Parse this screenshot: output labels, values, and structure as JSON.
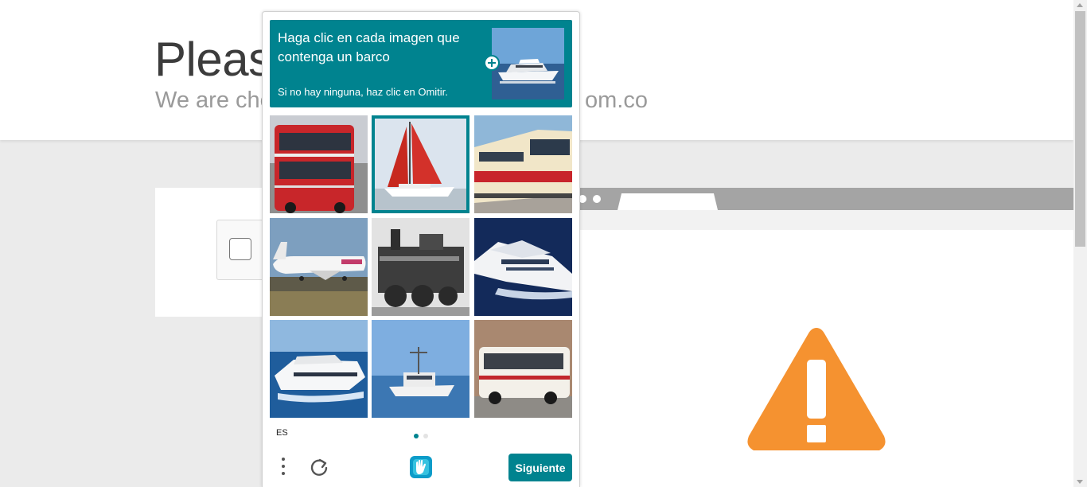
{
  "page": {
    "title": "Please",
    "subtitle_start": "We are che",
    "subtitle_end": "om.co"
  },
  "captcha": {
    "prompt_title": "Haga clic en cada imagen que contenga un barco",
    "prompt_subtitle": "Si no hay ninguna, haz clic en Omitir.",
    "language": "ES",
    "next_label": "Siguiente",
    "accent_color": "#00838f",
    "tiles": [
      {
        "subject": "red double-decker bus",
        "selected": false
      },
      {
        "subject": "sailboat with red sails",
        "selected": true
      },
      {
        "subject": "red and cream train",
        "selected": false
      },
      {
        "subject": "airplane on runway",
        "selected": false
      },
      {
        "subject": "steam locomotive",
        "selected": false
      },
      {
        "subject": "white yacht",
        "selected": false
      },
      {
        "subject": "white yacht",
        "selected": false
      },
      {
        "subject": "fishing boat",
        "selected": false
      },
      {
        "subject": "white coach bus",
        "selected": false
      }
    ],
    "pager": {
      "current": 1,
      "total": 2
    }
  },
  "colors": {
    "warning": "#f59230",
    "background": "#ebebeb"
  }
}
